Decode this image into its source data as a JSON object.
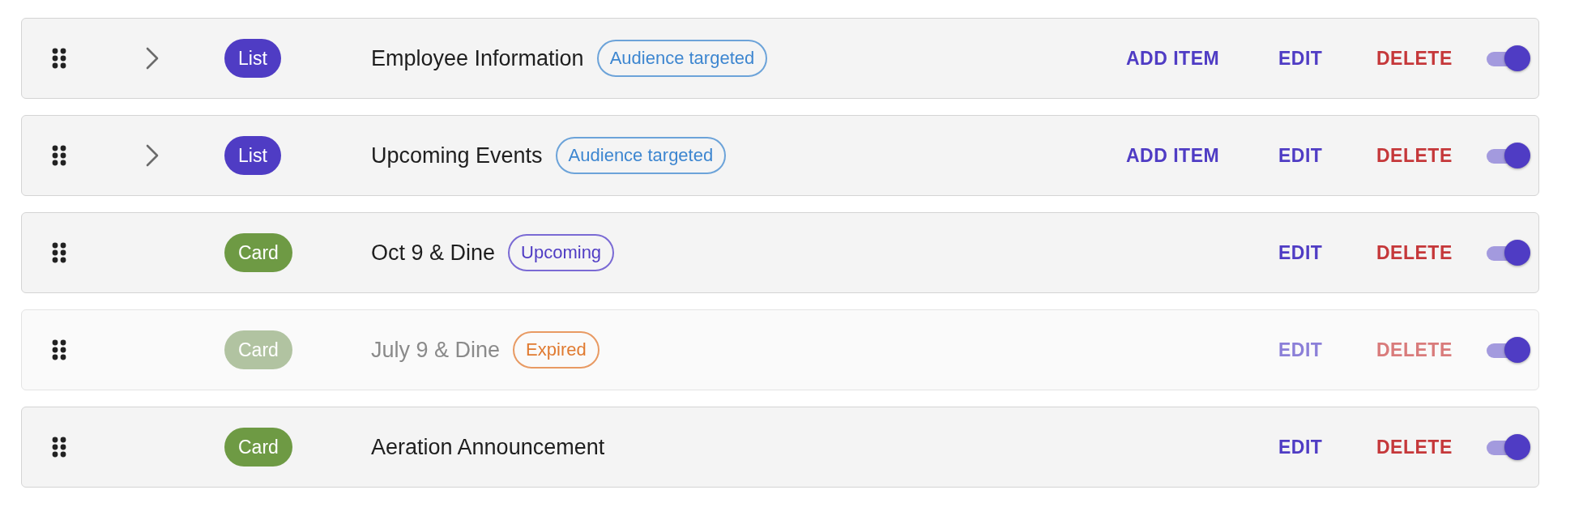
{
  "rows": [
    {
      "kind": "list",
      "type_label": "List",
      "expandable": true,
      "expanded": false,
      "title": "Employee Information",
      "badge": {
        "kind": "audience",
        "label": "Audience targeted"
      },
      "disabled": false,
      "on": true,
      "actions": [
        {
          "kind": "add",
          "label": "ADD ITEM"
        },
        {
          "kind": "edit",
          "label": "EDIT"
        },
        {
          "kind": "delete",
          "label": "DELETE"
        }
      ]
    },
    {
      "kind": "list",
      "type_label": "List",
      "expandable": true,
      "expanded": false,
      "title": "Upcoming Events",
      "badge": {
        "kind": "audience",
        "label": "Audience targeted"
      },
      "disabled": false,
      "on": true,
      "actions": [
        {
          "kind": "add",
          "label": "ADD ITEM"
        },
        {
          "kind": "edit",
          "label": "EDIT"
        },
        {
          "kind": "delete",
          "label": "DELETE"
        }
      ]
    },
    {
      "kind": "card",
      "type_label": "Card",
      "expandable": false,
      "title": "Oct 9 & Dine",
      "badge": {
        "kind": "upcoming",
        "label": "Upcoming"
      },
      "disabled": false,
      "on": true,
      "actions": [
        {
          "kind": "edit",
          "label": "EDIT"
        },
        {
          "kind": "delete",
          "label": "DELETE"
        }
      ]
    },
    {
      "kind": "card",
      "type_label": "Card",
      "expandable": false,
      "title": "July 9 & Dine",
      "badge": {
        "kind": "expired",
        "label": "Expired"
      },
      "disabled": true,
      "on": true,
      "actions": [
        {
          "kind": "edit",
          "label": "EDIT"
        },
        {
          "kind": "delete",
          "label": "DELETE"
        }
      ]
    },
    {
      "kind": "card",
      "type_label": "Card",
      "expandable": false,
      "title": "Aeration Announcement",
      "disabled": false,
      "on": true,
      "actions": [
        {
          "kind": "edit",
          "label": "EDIT"
        },
        {
          "kind": "delete",
          "label": "DELETE"
        }
      ]
    }
  ]
}
